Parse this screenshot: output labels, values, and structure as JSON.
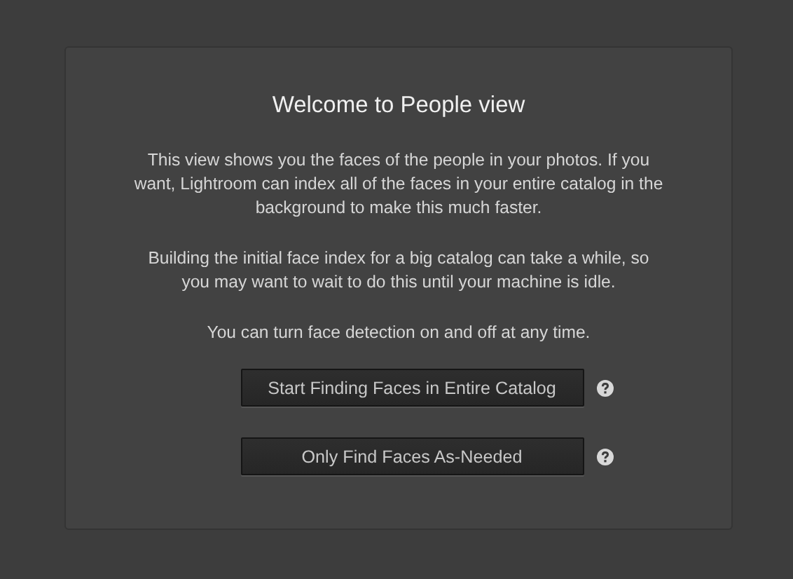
{
  "panel": {
    "title": "Welcome to People view",
    "paragraphs": [
      "This view shows you the faces of the people in your photos. If you want, Lightroom can index all of the faces in your entire catalog in the background to make this much faster.",
      "Building the initial face index for a big catalog can take a while, so you may want to wait to do this until your machine is idle.",
      "You can turn face detection on and off at any time."
    ],
    "buttons": [
      {
        "label": "Start Finding Faces in Entire Catalog",
        "help": true
      },
      {
        "label": "Only Find Faces As-Needed",
        "help": true
      }
    ]
  }
}
